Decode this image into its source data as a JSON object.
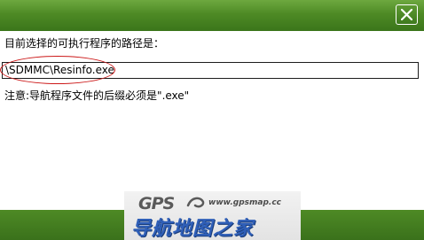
{
  "dialog": {
    "prompt": "目前选择的可执行程序的路径是：",
    "path_value": "\\SDMMC\\Resinfo.exe",
    "note": "注意:导航程序文件的后缀必须是\".exe\""
  },
  "watermark": {
    "logo_text": "GPS",
    "url": "www.gpsmap.cc",
    "cn_text": "导航地图之家"
  },
  "colors": {
    "title_green": "#4e8a25",
    "highlight_red": "#cc1818",
    "watermark_blue": "#2f5fb8"
  }
}
